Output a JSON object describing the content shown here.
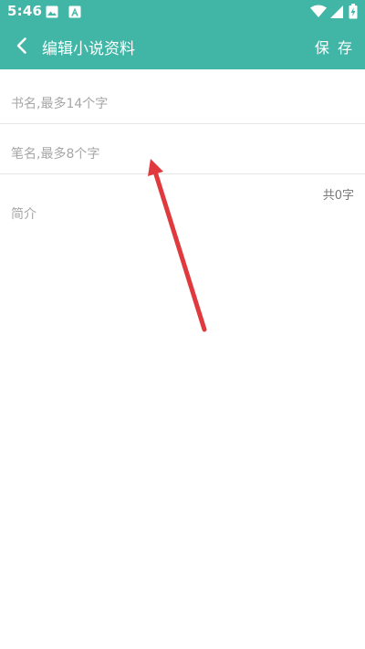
{
  "status_bar": {
    "time": "5:46",
    "icons": [
      "image-icon",
      "a-notification-icon",
      "wifi-icon",
      "signal-icon",
      "battery-charging-icon"
    ]
  },
  "toolbar": {
    "back_icon": "chevron-left-icon",
    "title": "编辑小说资料",
    "save_label": "保 存"
  },
  "form": {
    "title_placeholder": "书名,最多14个字",
    "title_value": "",
    "pen_name_placeholder": "笔名,最多8个字",
    "pen_name_value": "",
    "intro_placeholder": "简介",
    "intro_value": "",
    "char_count": "共0字"
  },
  "overlay": {
    "annotation_arrow_color": "#e0393e"
  },
  "colors": {
    "primary": "#42b6a6",
    "on_primary": "#ffffff",
    "placeholder": "#a6a6a6",
    "divider": "#e6e6e6"
  }
}
